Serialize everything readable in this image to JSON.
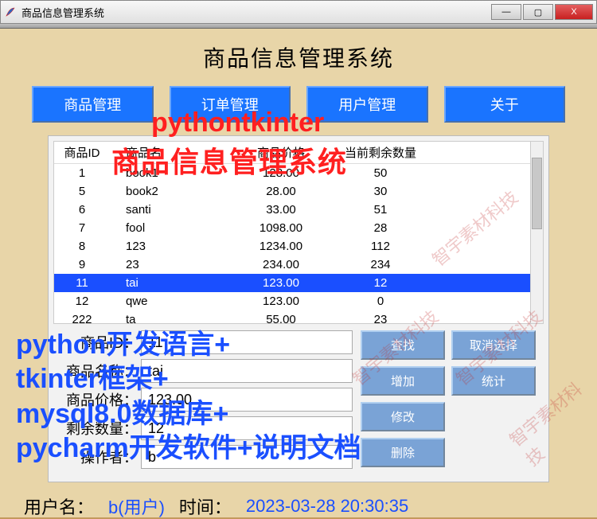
{
  "window": {
    "title": "商品信息管理系统",
    "min": "—",
    "max": "▢",
    "close": "X"
  },
  "heading": "商品信息管理系统",
  "nav": {
    "products": "商品管理",
    "orders": "订单管理",
    "users": "用户管理",
    "about": "关于"
  },
  "table": {
    "headers": {
      "id": "商品ID",
      "name": "商品名",
      "price": "商品价格",
      "qty": "当前剩余数量"
    },
    "rows": [
      {
        "id": "1",
        "name": "book1",
        "price": "128.00",
        "qty": "50",
        "sel": false
      },
      {
        "id": "5",
        "name": "book2",
        "price": "28.00",
        "qty": "30",
        "sel": false
      },
      {
        "id": "6",
        "name": "santi",
        "price": "33.00",
        "qty": "51",
        "sel": false
      },
      {
        "id": "7",
        "name": "fool",
        "price": "1098.00",
        "qty": "28",
        "sel": false
      },
      {
        "id": "8",
        "name": "123",
        "price": "1234.00",
        "qty": "112",
        "sel": false
      },
      {
        "id": "9",
        "name": "23",
        "price": "234.00",
        "qty": "234",
        "sel": false
      },
      {
        "id": "11",
        "name": "tai",
        "price": "123.00",
        "qty": "12",
        "sel": true
      },
      {
        "id": "12",
        "name": "qwe",
        "price": "123.00",
        "qty": "0",
        "sel": false
      },
      {
        "id": "222",
        "name": "ta",
        "price": "55.00",
        "qty": "23",
        "sel": false
      }
    ]
  },
  "form": {
    "id_label": "商品ID：",
    "id_value": "11",
    "name_label": "商品名称：",
    "name_value": "tai",
    "price_label": "商品价格：",
    "price_value": "123.00",
    "qty_label": "剩余数量：",
    "qty_value": "12",
    "op_label": "操作者：",
    "op_value": "b"
  },
  "buttons": {
    "search": "查找",
    "cancel_sel": "取消选择",
    "add": "增加",
    "stats": "统计",
    "edit": "修改",
    "delete": "删除"
  },
  "footer": {
    "user_label": "用户名：",
    "user_value": "b(用户)",
    "time_label": "时间：",
    "time_value": "2023-03-28 20:30:35"
  },
  "overlay": {
    "red1": "pythontkinter",
    "red2": "商品信息管理系统",
    "blue1": "python开发语言+",
    "blue2": "tkinter框架+",
    "blue3": "mysql8.0数据库+",
    "blue4": "pycharm开发软件+说明文档",
    "watermark": "智宇素材科技"
  }
}
